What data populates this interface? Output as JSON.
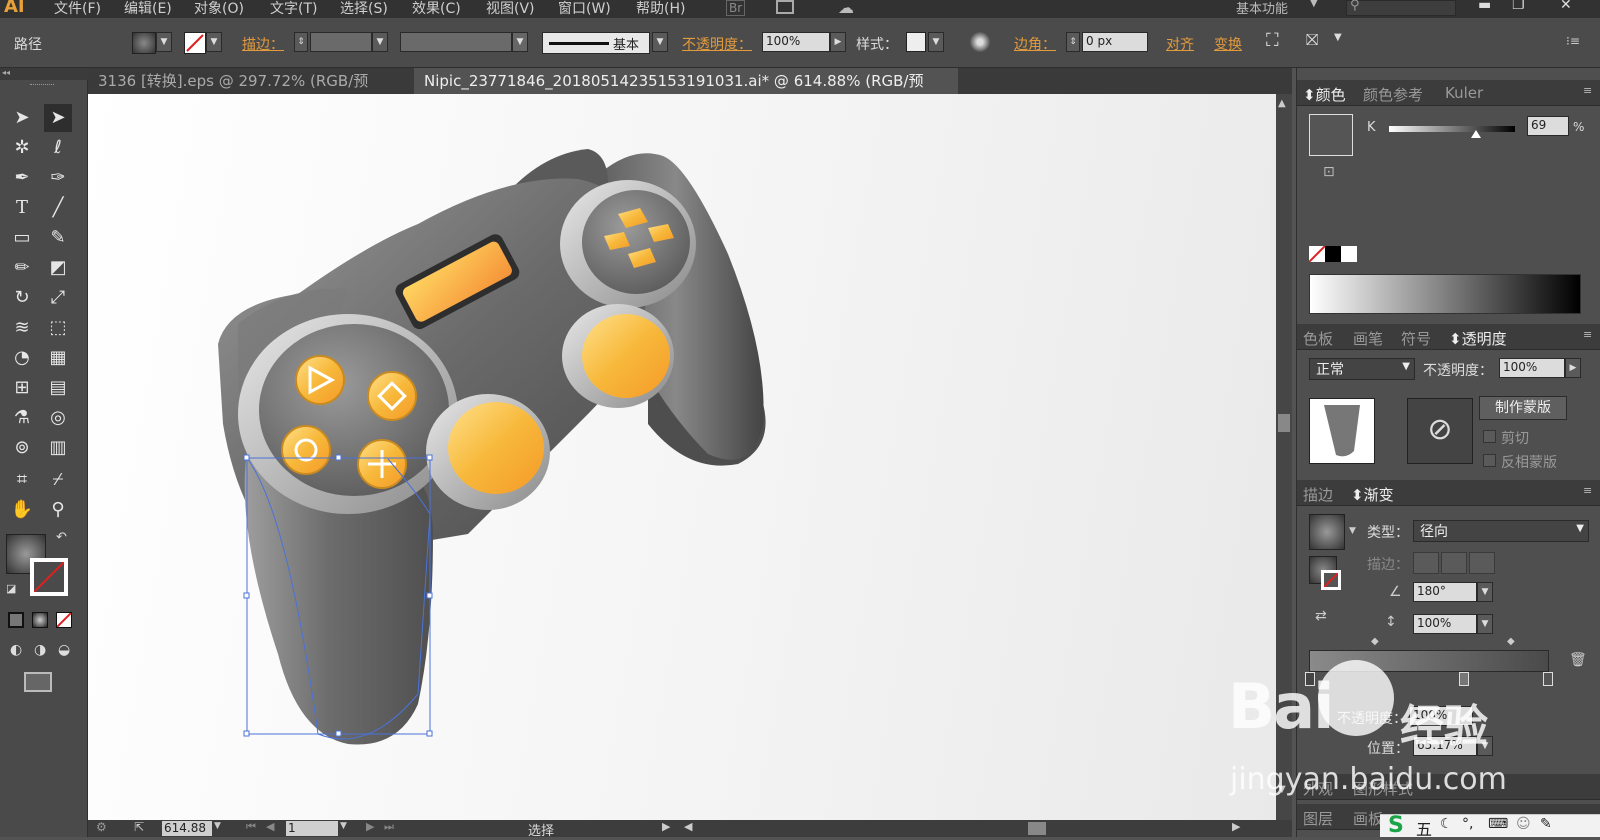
{
  "app": {
    "logo": "AI",
    "workspace": "基本功能"
  },
  "menu": [
    "文件(F)",
    "编辑(E)",
    "对象(O)",
    "文字(T)",
    "选择(S)",
    "效果(C)",
    "视图(V)",
    "窗口(W)",
    "帮助(H)"
  ],
  "menu_extra": {
    "bridge": "Br"
  },
  "control": {
    "object_type": "路径",
    "stroke_label": "描边：",
    "stroke_style": "基本",
    "opacity_label": "不透明度：",
    "opacity_value": "100%",
    "style_label": "样式：",
    "corner_label": "边角：",
    "corner_value": "0 px",
    "align_label": "对齐",
    "transform_label": "变换"
  },
  "tabs": [
    {
      "label": "3136 [转换].eps @ 297.72% (RGB/预览)",
      "close": "×",
      "active": false
    },
    {
      "label": "Nipic_23771846_20180514235153191031.ai* @ 614.88% (RGB/预览)",
      "close": "×",
      "active": true
    }
  ],
  "status": {
    "zoom": "614.88",
    "artboard": "1",
    "tool": "选择"
  },
  "panels": {
    "color": {
      "tabs": [
        "颜色",
        "颜色参考",
        "Kuler"
      ],
      "channel": "K",
      "value": "69",
      "unit": "%",
      "level": 0.69
    },
    "transparency": {
      "tabs": [
        "色板",
        "画笔",
        "符号",
        "透明度"
      ],
      "blend_mode": "正常",
      "opacity_label": "不透明度：",
      "opacity_value": "100%",
      "make_mask": "制作蒙版",
      "clip": "剪切",
      "invert": "反相蒙版"
    },
    "gradient": {
      "tabs": [
        "描边",
        "渐变"
      ],
      "type_label": "类型：",
      "type_value": "径向",
      "stroke_label": "描边：",
      "angle": "180°",
      "aspect": "100%",
      "opacity_label": "不透明度：",
      "opacity_value": "100%",
      "position_label": "位置：",
      "position_value": "65.17%"
    },
    "bottom": {
      "tabs": [
        "外观",
        "图形样式"
      ],
      "tabs2": [
        "图层",
        "画板"
      ]
    }
  },
  "watermark": {
    "brand": "Bai",
    "brand2": "经验",
    "url": "jingyan.baidu.com"
  },
  "taskbar": {
    "ime": "五"
  },
  "colors": {
    "accent": "#e29a3c",
    "selection": "#4a72d8",
    "button_gold": "#f4b43a"
  }
}
